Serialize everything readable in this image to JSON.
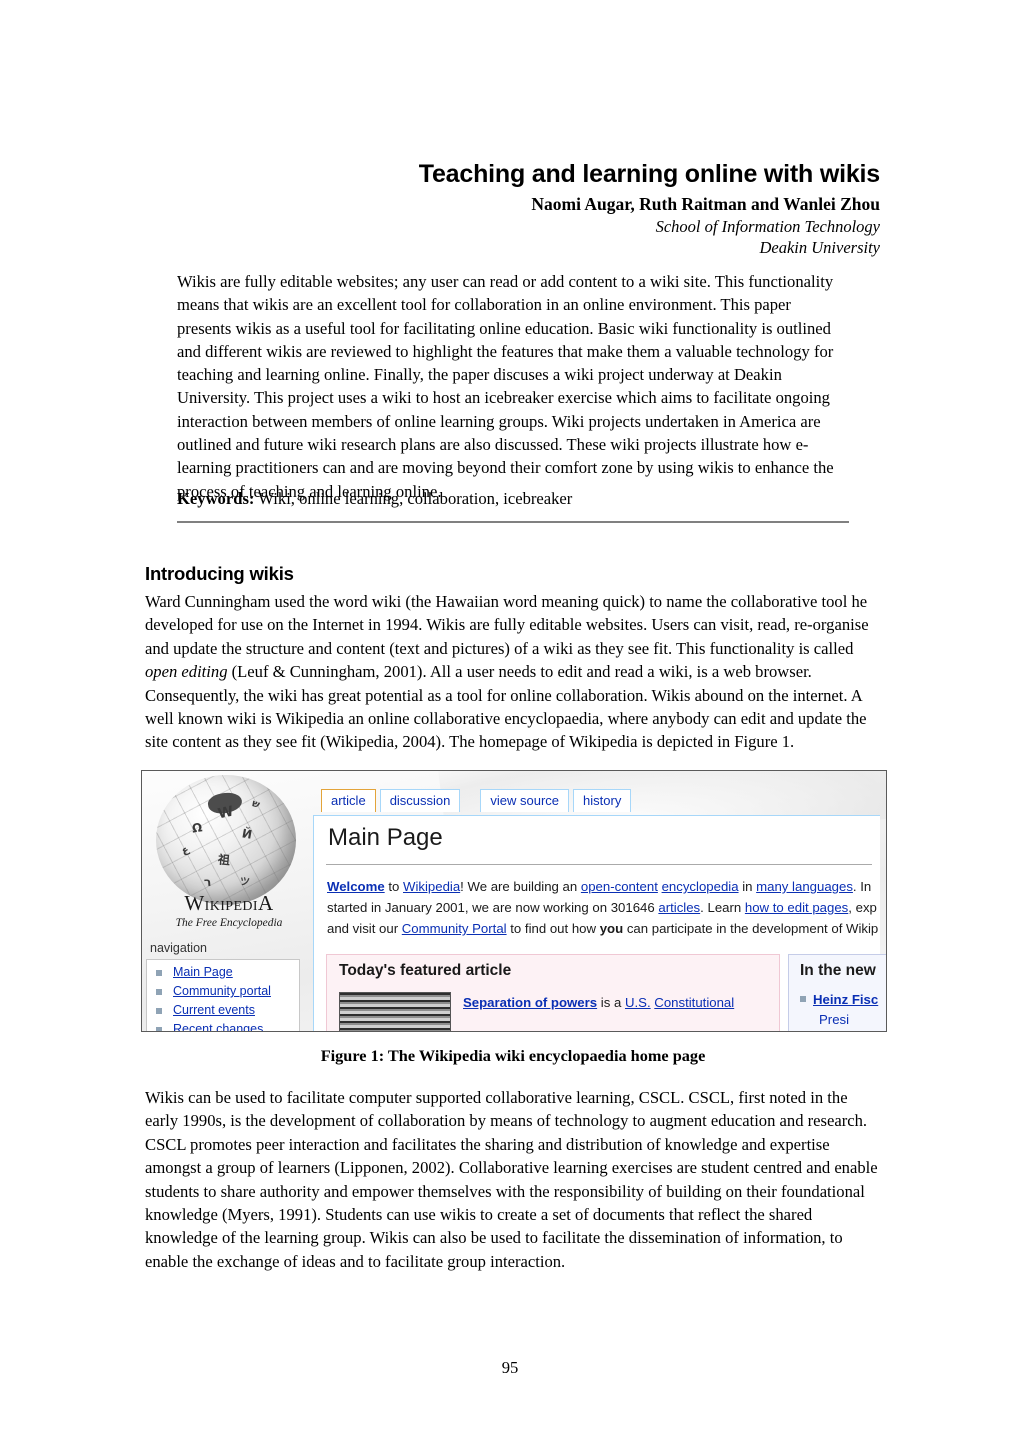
{
  "document": {
    "title": "Teaching and learning online with wikis",
    "authors": "Naomi Augar, Ruth Raitman and Wanlei Zhou",
    "affiliation_line1": "School of Information Technology",
    "affiliation_line2": "Deakin University",
    "page_number": "95"
  },
  "abstract": {
    "text": "Wikis are fully editable websites; any user can read or add content to a wiki site. This functionality means that wikis are an excellent tool for collaboration in an online environment. This paper presents wikis as a useful tool for facilitating online education. Basic wiki functionality is outlined and different wikis are reviewed to highlight the features that make them a valuable technology for teaching and learning online. Finally, the paper discuses a wiki project underway at Deakin University. This project uses a wiki to host an icebreaker exercise which aims to facilitate ongoing interaction between members of online learning groups. Wiki projects undertaken in America are outlined and future wiki research plans are also discussed. These wiki projects illustrate how e-learning practitioners can and are moving beyond their comfort zone by using wikis to enhance the process of teaching and learning online."
  },
  "keywords": {
    "label": "Keywords:",
    "value": "Wiki, online learning, collaboration, icebreaker"
  },
  "section": {
    "heading": "Introducing wikis",
    "paragraph_1_part_a": "Ward Cunningham used the word wiki (the Hawaiian word meaning quick) to name the collaborative tool he developed for use on the Internet in 1994. Wikis are fully editable websites. Users can visit, read, re-organise and update the structure and content (text and pictures) of a wiki as they see fit. This functionality is called ",
    "paragraph_1_italic": "open editing",
    "paragraph_1_part_b": " (Leuf & Cunningham, 2001). All a user needs to edit and read a wiki, is a web browser. Consequently, the wiki has great potential as a tool for online collaboration. Wikis abound on the internet. A well known wiki is Wikipedia an online collaborative encyclopaedia, where anybody can edit and update the site content as they see fit (Wikipedia, 2004). The homepage of Wikipedia is depicted in Figure 1.",
    "paragraph_2": "Wikis can be used to facilitate computer supported collaborative learning, CSCL. CSCL, first noted in the early 1990s, is the development of collaboration by means of technology to augment education and research. CSCL promotes peer interaction and facilitates the sharing and distribution of knowledge and expertise amongst a group of learners (Lipponen, 2002). Collaborative learning exercises are student centred and enable students to share authority and empower themselves with the responsibility of building on their foundational knowledge (Myers, 1991). Students can use wikis to create a set of documents that reflect the shared knowledge of the learning group. Wikis can also be used to facilitate the dissemination of information, to enable the exchange of ideas and to facilitate group interaction."
  },
  "figure": {
    "caption": "Figure 1: The Wikipedia wiki encyclopaedia home page",
    "screenshot": {
      "wordmark_main": "IKIPEDI",
      "wordmark_w": "W",
      "wordmark_a": "A",
      "tagline": "The Free Encyclopedia",
      "nav_label": "navigation",
      "nav_items": [
        "Main Page",
        "Community portal",
        "Current events",
        "Recent changes"
      ],
      "tabs": [
        {
          "label": "article",
          "active": true
        },
        {
          "label": "discussion",
          "active": false
        },
        {
          "label": "view source",
          "active": false
        },
        {
          "label": "history",
          "active": false
        }
      ],
      "page_title": "Main Page",
      "welcome": {
        "line1_welcome": "Welcome",
        "line1_a": " to ",
        "line1_wikipedia": "Wikipedia",
        "line1_b": "! We are building an ",
        "line1_open": "open-content",
        "line1_c": " ",
        "line1_encyclopedia": "encyclopedia",
        "line1_d": " in ",
        "line1_langs": "many languages",
        "line1_e": ". In",
        "line2_a": "started in January 2001, we are now working on 301646 ",
        "line2_articles": "articles",
        "line2_b": ". Learn ",
        "line2_edit": "how to edit pages",
        "line2_c": ", exp",
        "line3_a": "and visit our ",
        "line3_portal": "Community Portal",
        "line3_b": " to find out how ",
        "line3_you": "you",
        "line3_c": " can participate in the development of Wikip"
      },
      "featured": {
        "heading": "Today's featured article",
        "lead_link": "Separation of powers",
        "body_a": " is a ",
        "link_us": "U.S.",
        "body_b": " ",
        "link_const": "Constitutional"
      },
      "in_the_news": {
        "heading": "In the new",
        "item1": "Heinz Fisc",
        "item2": "Presi"
      }
    },
    "colors": {
      "link": "#0a2fb4",
      "tab_active_border": "#e3a43a",
      "tab_border": "#a7d7f9",
      "featured_bg": "#fdf2f5",
      "news_bg": "#f4f6fd"
    }
  }
}
